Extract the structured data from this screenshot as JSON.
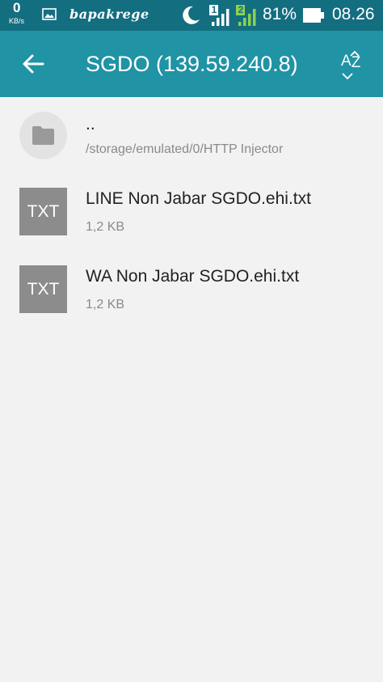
{
  "status_bar": {
    "net_speed_value": "0",
    "net_speed_unit": "KB/s",
    "carrier": "bapakrege",
    "battery_percent": "81%",
    "time": "08.26",
    "sim1_label": "1",
    "sim2_label": "2",
    "icons": [
      "image-icon",
      "moon-icon",
      "signal-icon",
      "battery-icon"
    ],
    "colors": {
      "background": "#136e80",
      "sim2_accent": "#8bd14f"
    }
  },
  "app_bar": {
    "title": "SGDO (139.59.240.8)",
    "sort_label_a": "A",
    "sort_label_z": "Z",
    "icons": [
      "back-arrow-icon",
      "sort-az-icon"
    ],
    "colors": {
      "background": "#2093a5"
    }
  },
  "file_list": {
    "parent": {
      "name": "..",
      "path": "/storage/emulated/0/HTTP Injector",
      "icon": "folder-icon"
    },
    "files": [
      {
        "name": "LINE Non Jabar SGDO.ehi.txt",
        "size": "1,2 KB",
        "type_label": "TXT",
        "icon": "txt-file-icon"
      },
      {
        "name": "WA Non Jabar SGDO.ehi.txt",
        "size": "1,2 KB",
        "type_label": "TXT",
        "icon": "txt-file-icon"
      }
    ]
  }
}
